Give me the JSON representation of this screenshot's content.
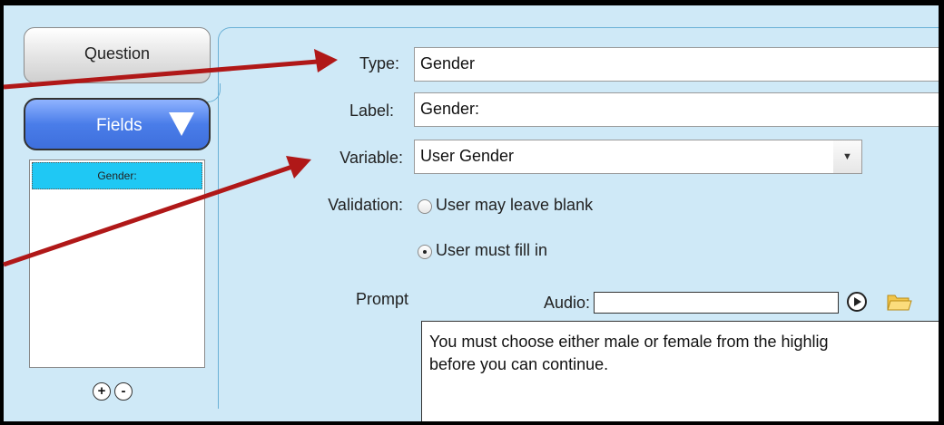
{
  "sidebar": {
    "question_tab": "Question",
    "fields_button": "Fields",
    "field_items": [
      "Gender:"
    ],
    "add_symbol": "+",
    "remove_symbol": "-"
  },
  "form": {
    "type_label": "Type:",
    "type_value": "Gender",
    "label_label": "Label:",
    "label_value": "Gender:",
    "variable_label": "Variable:",
    "variable_value": "User Gender",
    "validation_label": "Validation:",
    "validation_options": [
      {
        "label": "User may leave blank",
        "selected": false
      },
      {
        "label": "User must fill in",
        "selected": true
      }
    ],
    "prompt_label": "Prompt",
    "audio_label": "Audio:",
    "audio_value": "",
    "prompt_text_line1": "You must choose either male or female from the highlig",
    "prompt_text_line2": "before you can continue."
  },
  "colors": {
    "panel_bg": "#cfe9f7",
    "fields_blue": "#4a7de9",
    "selected_item": "#1fc8f4",
    "annotation_arrow": "#b01818"
  },
  "icons": [
    "chevron-down-icon",
    "play-icon",
    "folder-icon",
    "plus-icon",
    "minus-icon"
  ]
}
